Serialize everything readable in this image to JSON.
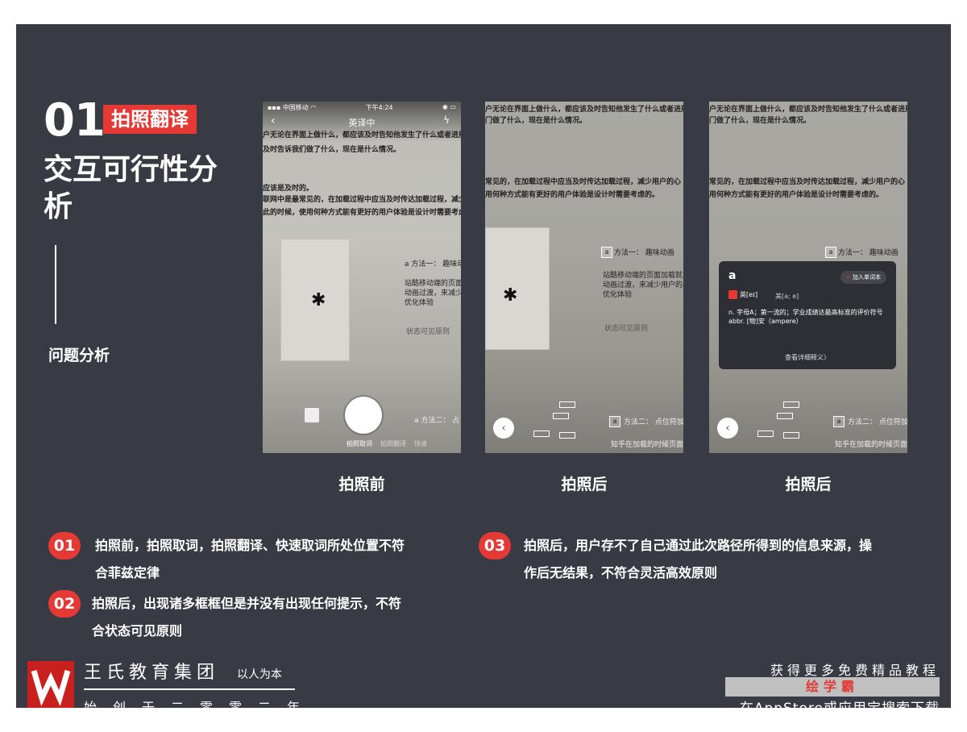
{
  "heading": {
    "number": "01",
    "tag": "拍照翻译",
    "title": "交互可行性分析",
    "subtitle": "问题分析"
  },
  "phones": [
    {
      "caption": "拍照前",
      "status": {
        "carrier": "中国移动",
        "time": "下午4:24"
      },
      "nav_title": "英译中",
      "lines": [
        "户无论在界面上做什么，都应该及时告知他发生了什么或者进展到什",
        "及时告诉我们做了什么，现在是什么情况。",
        "应该是及时的。",
        "联网中是最常见的，在加载过程中应当及时传达加载过程，减少用户",
        "此的时候，使用何种方式能有更好的用户体验是设计时需要考虑的。"
      ],
      "method1": "a  方法一：  趣味动",
      "card_lines": [
        "站酷移动端的页面加",
        "动画过渡，来减少用户",
        "优化体验"
      ],
      "status_line": "状态可见原则",
      "method2": "a  方法二：  占",
      "modes": [
        "拍照取词",
        "拍照翻译",
        "快速"
      ]
    },
    {
      "caption": "拍照后",
      "lines": [
        "户无论在界面上做什么，都应该及时告知他发生了什么或者进展到什",
        "门做了什么，现在是什么情况。",
        "常见的，在加载过程中应当及时传达加载过程，减少用户的心",
        "用何种方式能有更好的用户体验是设计时需要考虑的。"
      ],
      "method1": "方法一：  趣味动画",
      "card_lines": [
        "站酷移动端的页面加载就是",
        "动画过渡，来减少用户的心",
        "优化体验"
      ],
      "status_line": "状态可见原则",
      "method2": "方法二：  点位符加",
      "bottom_line": "知乎在加载的时候页面时",
      "box_letter": "a"
    },
    {
      "caption": "拍照后",
      "lines": [
        "户无论在界面上做什么，都应该及时告知他发生了什么或者进展到什",
        "门做了什么，现在是什么情况。",
        "常见的，在加载过程中应当及时传达加载过程，减少用户的心",
        "用何种方式能有更好的用户体验是设计时需要考虑的。"
      ],
      "method1": "方法一：  趣味动画",
      "method2": "方法二：  点位符加",
      "bottom_line": "知乎在加载的时候页面时",
      "box_letter": "a",
      "popup": {
        "word": "a",
        "add_label": "加入单词本",
        "uk": "英[eɪ]",
        "us": "美[a; e]",
        "def1": "n. 字母A；第一流的；学业成绩达最高标准的评价符号",
        "def2": "abbr. [物]安（ampere）",
        "more": "查看详细释义〉"
      }
    }
  ],
  "notes": [
    {
      "num": "01",
      "line1": "拍照前，拍照取词，拍照翻译、快速取词所处位置不符",
      "line2": "合菲兹定律"
    },
    {
      "num": "02",
      "line1": "拍照后，出现诸多框框但是并没有出现任何提示，不符",
      "line2": "合状态可见原则"
    },
    {
      "num": "03",
      "line1": "拍照后，用户存不了自己通过此次路径所得到的信息来源，操",
      "line2": "作后无结果，不符合灵活高效原则"
    }
  ],
  "footer": {
    "brand": "王氏教育集团",
    "slogan": "以人为本",
    "since": "始创于二零零二年",
    "promo_line1": "获得更多免费精品教程",
    "promo_line2": "绘学霸",
    "promo_line3": "在AppStore或应用宝搜索下载"
  },
  "colors": {
    "background": "#383b44",
    "accent": "#e53935"
  }
}
